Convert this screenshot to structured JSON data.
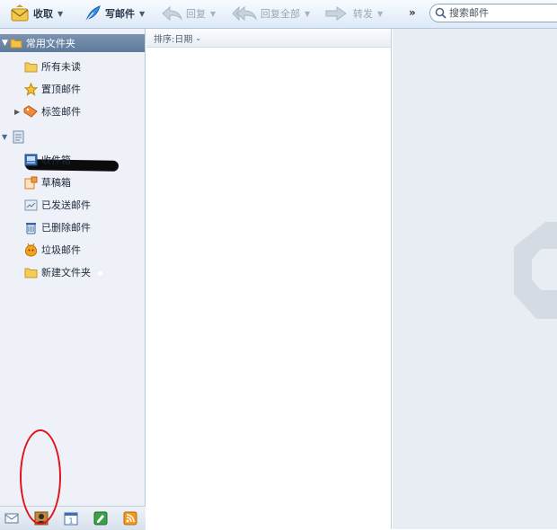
{
  "toolbar": {
    "receive_label": "收取",
    "compose_label": "写邮件",
    "reply_label": "回复",
    "reply_all_label": "回复全部",
    "forward_label": "转发",
    "more_label": "»",
    "search_placeholder": "搜索邮件"
  },
  "sidebar": {
    "favorites_header": "常用文件夹",
    "favorites": [
      {
        "label": "所有未读",
        "icon": "folder-icon"
      },
      {
        "label": "置顶邮件",
        "icon": "star-icon"
      },
      {
        "label": "标签邮件",
        "icon": "tag-icon"
      }
    ],
    "account_folders": [
      {
        "label": "收件箱",
        "icon": "inbox-icon"
      },
      {
        "label": "草稿箱",
        "icon": "drafts-icon"
      },
      {
        "label": "已发送邮件",
        "icon": "sent-icon"
      },
      {
        "label": "已删除邮件",
        "icon": "trash-icon"
      },
      {
        "label": "垃圾邮件",
        "icon": "spam-icon"
      },
      {
        "label": "新建文件夹",
        "icon": "folder-icon"
      }
    ],
    "footer_buttons": [
      "mail-icon",
      "contacts-icon",
      "calendar-icon",
      "notes-icon",
      "rss-icon"
    ]
  },
  "list": {
    "sort_label": "排序:日期"
  },
  "colors": {
    "accent_header": "#6a84a5",
    "annotation_circle": "#e0141d",
    "toolbar_bg": "#e6eef8"
  }
}
